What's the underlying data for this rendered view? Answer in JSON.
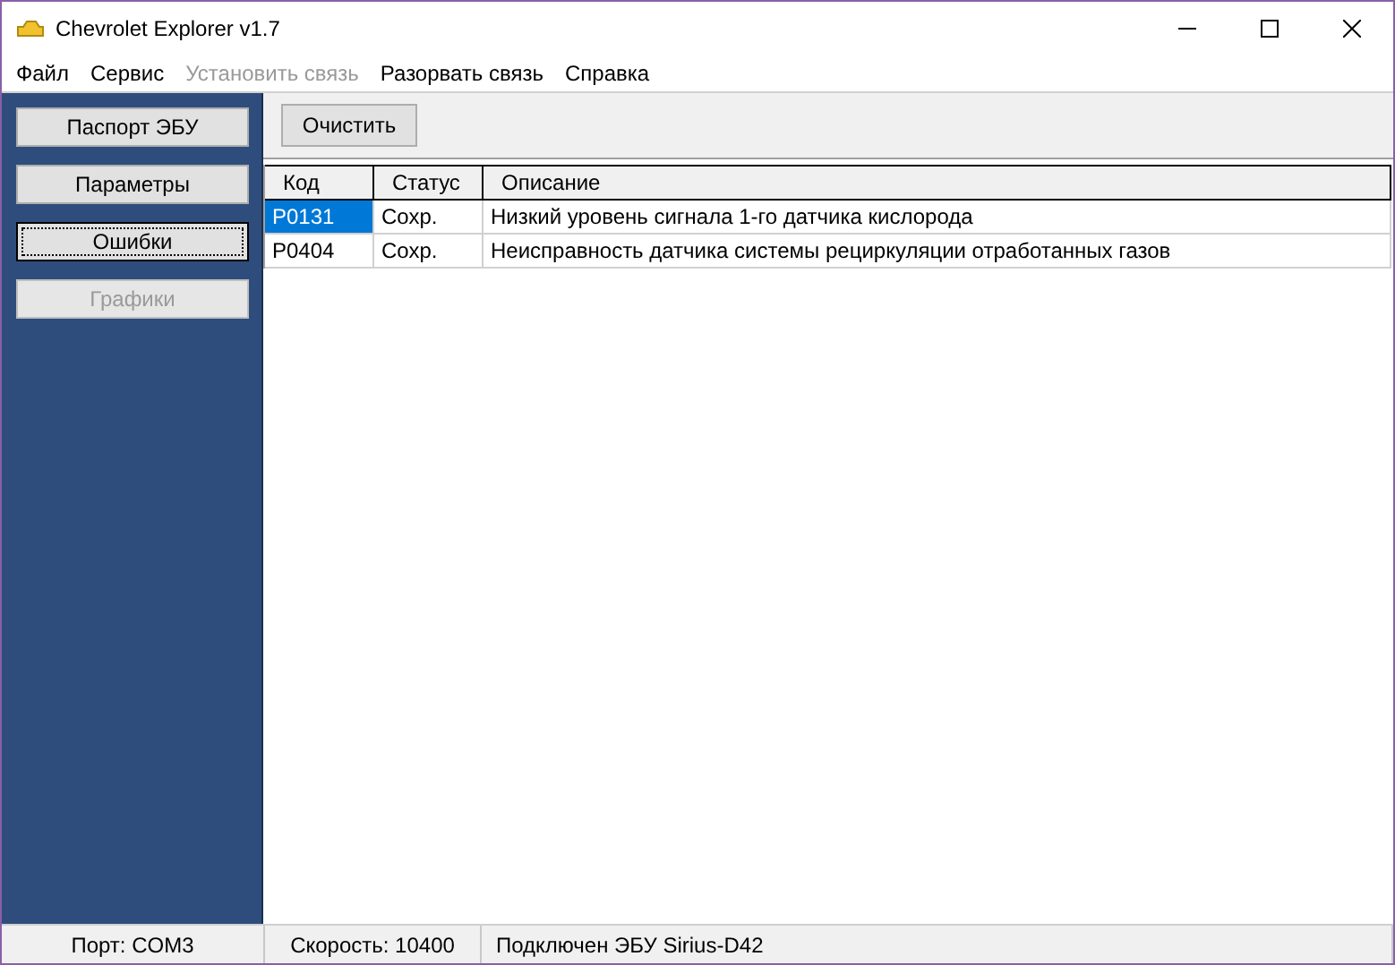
{
  "window": {
    "title": "Chevrolet Explorer v1.7"
  },
  "menu": [
    {
      "label": "Файл",
      "disabled": false
    },
    {
      "label": "Сервис",
      "disabled": false
    },
    {
      "label": "Установить связь",
      "disabled": true
    },
    {
      "label": "Разорвать связь",
      "disabled": false
    },
    {
      "label": "Справка",
      "disabled": false
    }
  ],
  "sidebar": {
    "items": [
      {
        "label": "Паспорт ЭБУ",
        "selected": false,
        "disabled": false
      },
      {
        "label": "Параметры",
        "selected": false,
        "disabled": false
      },
      {
        "label": "Ошибки",
        "selected": true,
        "disabled": false
      },
      {
        "label": "Графики",
        "selected": false,
        "disabled": true
      }
    ]
  },
  "toolbar": {
    "buttons": [
      "Очистить"
    ]
  },
  "table": {
    "columns": [
      "Код",
      "Статус",
      "Описание"
    ],
    "rows": [
      {
        "selected": true,
        "cells": [
          "P0131",
          "Сохр.",
          "Низкий уровень сигнала 1-го датчика кислорода"
        ]
      },
      {
        "selected": false,
        "cells": [
          "P0404",
          "Сохр.",
          "Неисправность датчика системы рециркуляции отработанных газов"
        ]
      }
    ]
  },
  "status_bar": [
    "Порт: COM3",
    "Скорость: 10400",
    "Подключен ЭБУ Sirius-D42"
  ]
}
